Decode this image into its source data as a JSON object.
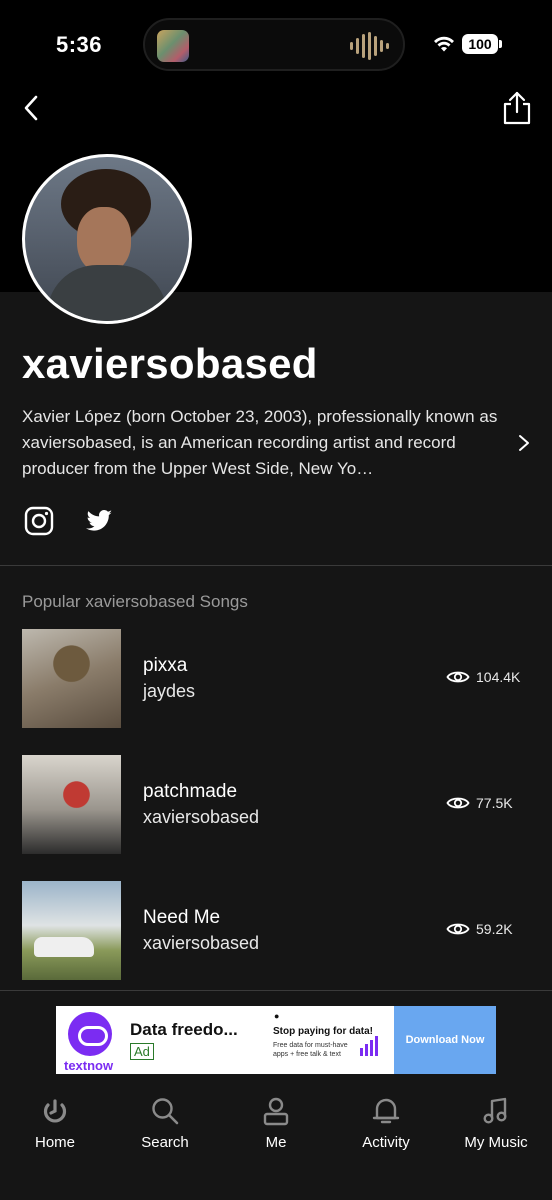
{
  "status_bar": {
    "time": "5:36",
    "battery": "100"
  },
  "header": {
    "back_icon": "chevron-left-icon",
    "share_icon": "share-icon"
  },
  "artist": {
    "name": "xaviersobased",
    "bio": "Xavier López (born October 23, 2003), professionally known as xaviersobased, is an American recording artist and record producer from the Upper West Side, New Yo…",
    "socials": [
      "instagram-icon",
      "twitter-icon"
    ]
  },
  "popular": {
    "title": "Popular xaviersobased Songs",
    "songs": [
      {
        "title": "pixxa",
        "artist": "jaydes",
        "views": "104.4K"
      },
      {
        "title": "patchmade",
        "artist": "xaviersobased",
        "views": "77.5K"
      },
      {
        "title": "Need Me",
        "artist": "xaviersobased",
        "views": "59.2K"
      }
    ]
  },
  "ad": {
    "brand": "textnow",
    "title": "Data freedo...",
    "badge": "Ad",
    "promo_head": "Stop paying for data!",
    "promo_sub": "Free data for must-have apps + free talk & text",
    "cta": "Download Now"
  },
  "tabs": [
    {
      "label": "Home",
      "icon": "home-icon"
    },
    {
      "label": "Search",
      "icon": "search-icon"
    },
    {
      "label": "Me",
      "icon": "person-icon"
    },
    {
      "label": "Activity",
      "icon": "bell-icon"
    },
    {
      "label": "My Music",
      "icon": "music-note-icon"
    }
  ]
}
